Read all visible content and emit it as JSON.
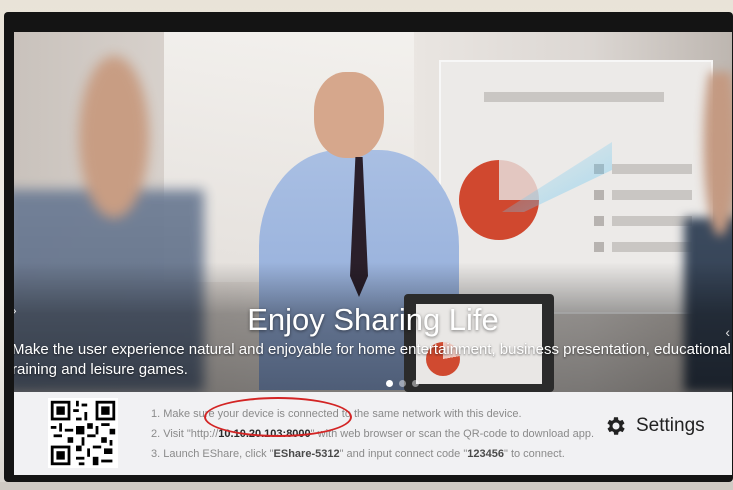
{
  "hero": {
    "headline": "Enjoy Sharing Life",
    "tagline_line1": "Make the user experience natural and enjoyable for home entertainment, business presentation, educational",
    "tagline_line2": "raining and leisure games.",
    "carousel_left_glyph": "›",
    "carousel_right_glyph": "‹",
    "dots": 3,
    "active_dot": 1
  },
  "instructions": {
    "step1": "1. Make sure your device is connected to the same network with this device.",
    "step2_prefix": "2. Visit \"http://",
    "step2_ip": "10.10.20.103:8000",
    "step2_suffix": "\" with web browser or scan the QR-code to download app.",
    "step3_prefix": "3. Launch EShare, click \"",
    "step3_device": "EShare-5312",
    "step3_middle": "\" and input connect code \"",
    "step3_code": "123456",
    "step3_suffix": "\" to connect."
  },
  "settings": {
    "label": "Settings",
    "icon": "gear-icon"
  },
  "colors": {
    "highlight_circle": "#d32424",
    "panel_bg": "#f1f1f3"
  }
}
